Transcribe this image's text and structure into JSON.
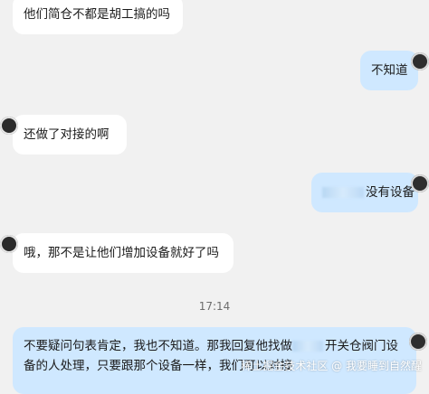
{
  "messages": [
    {
      "id": "m1",
      "side": "left",
      "text": "他们简仓不都是胡工搞的吗"
    },
    {
      "id": "m2",
      "side": "right",
      "text": "不知道"
    },
    {
      "id": "m3",
      "side": "left",
      "text": "还做了对接的啊"
    },
    {
      "id": "m4",
      "side": "right",
      "text": "没有设备"
    },
    {
      "id": "m5",
      "side": "left",
      "text": "哦，那不是让他们增加设备就好了吗"
    },
    {
      "id": "m6",
      "side": "right",
      "line1a": "不要疑问句表肯定，我也不知道。那我回复他找做",
      "line1b": "开关仓阀门设",
      "line2": "备的人处理，只要跟那个设备一样，我们可以对接"
    }
  ],
  "timestamp": "17:14",
  "watermark": "稀土掘金技术社区 @ 我要睡到自然醒"
}
